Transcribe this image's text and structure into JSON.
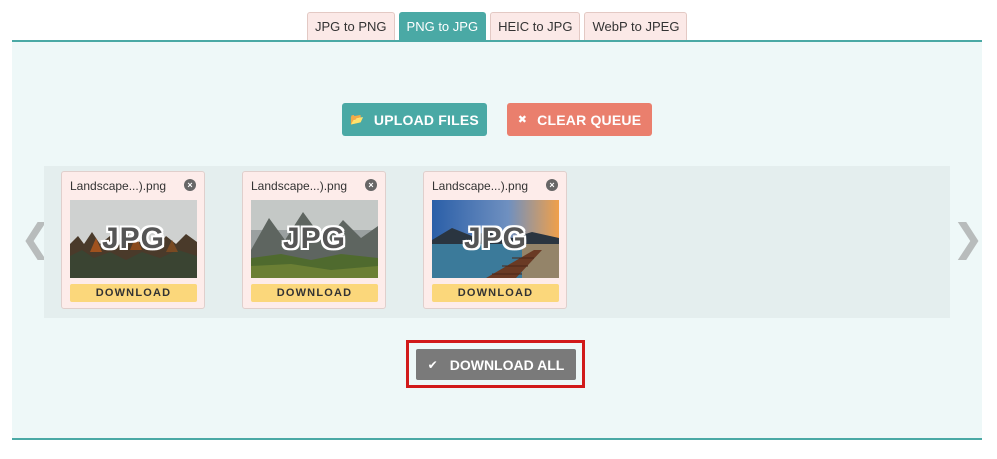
{
  "tabs": [
    {
      "label": "JPG to PNG",
      "active": false
    },
    {
      "label": "PNG to JPG",
      "active": true
    },
    {
      "label": "HEIC to JPG",
      "active": false
    },
    {
      "label": "WebP to JPEG",
      "active": false
    }
  ],
  "actions": {
    "upload_label": "UPLOAD FILES",
    "upload_icon": "folder-open-icon",
    "clear_label": "CLEAR QUEUE",
    "clear_icon": "x-icon"
  },
  "queue": {
    "prev_icon": "chevron-left-icon",
    "next_icon": "chevron-right-icon",
    "files": [
      {
        "name": "Landscape...).png",
        "badge": "JPG",
        "download_label": "DOWNLOAD"
      },
      {
        "name": "Landscape...).png",
        "badge": "JPG",
        "download_label": "DOWNLOAD"
      },
      {
        "name": "Landscape...).png",
        "badge": "JPG",
        "download_label": "DOWNLOAD"
      }
    ]
  },
  "download_all": {
    "label": "DOWNLOAD ALL",
    "icon": "check-icon"
  },
  "colors": {
    "accent": "#4aa9a5",
    "clear": "#ea7f6d",
    "download": "#fbd77b",
    "download_all": "#7a7a7a",
    "highlight": "#d11a1a"
  }
}
